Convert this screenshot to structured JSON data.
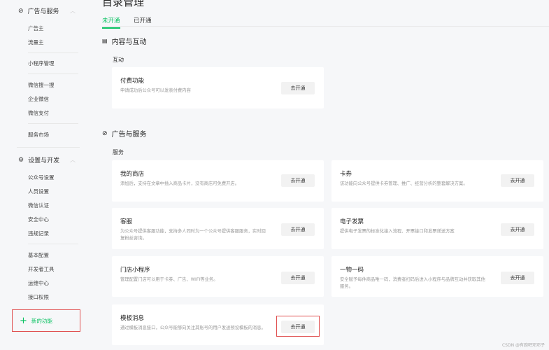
{
  "sidebar": {
    "groups": [
      {
        "label": "广告与服务",
        "icon": "compass-icon"
      },
      {
        "label": "设置与开发",
        "icon": "gear-icon"
      }
    ],
    "items": [
      "广告主",
      "流量主",
      "小程序管理",
      "微信搜一搜",
      "企业微信",
      "微信支付",
      "服务市场",
      "公众号设置",
      "人员设置",
      "微信认证",
      "安全中心",
      "违规记录",
      "基本配置",
      "开发者工具",
      "运维中心",
      "接口权限"
    ],
    "new_feature": "新的功能"
  },
  "main": {
    "title": "目录管理",
    "tabs": [
      "未开通",
      "已开通"
    ],
    "sections": [
      {
        "title": "内容与互动",
        "subtitle": "互动",
        "cards": [
          {
            "title": "付费功能",
            "desc": "申请成功后公众号可以发表付费内容",
            "button": "去开通"
          }
        ]
      },
      {
        "title": "广告与服务",
        "subtitle": "服务",
        "cards": [
          {
            "title": "我的商店",
            "desc": "添加后，支持在文章中插入商品卡片，没有商店可免费开店。",
            "button": "去开通"
          },
          {
            "title": "卡券",
            "desc": "该功能向公众号提供卡券管理、推广、经营分析的整套解决方案。",
            "button": "去开通"
          },
          {
            "title": "客服",
            "desc": "为公众号提供客服功能，支持多人同时为一个公众号提供客服服务，实时回复粉丝咨询。",
            "button": "去开通"
          },
          {
            "title": "电子发票",
            "desc": "提供电子发票的标准化接入流程、开票接口和发票递送方案",
            "button": "去开通"
          },
          {
            "title": "门店小程序",
            "desc": "管理配置门店可以用于卡券、广告、WIFI等业务。",
            "button": "去开通"
          },
          {
            "title": "一物一码",
            "desc": "安全赋予每件商品唯一码，消费者扫码后进入小程序与品牌互动并获取其他服务。",
            "button": "去开通"
          },
          {
            "title": "模板消息",
            "desc": "通过模板消息接口，公众号能够向关注其账号的用户发送预设模板的消息。",
            "button": "去开通"
          }
        ]
      }
    ]
  },
  "watermark": "CSDN @有跑吧邓邓子",
  "colors": {
    "accent": "#07c160",
    "highlight": "#e05050"
  }
}
